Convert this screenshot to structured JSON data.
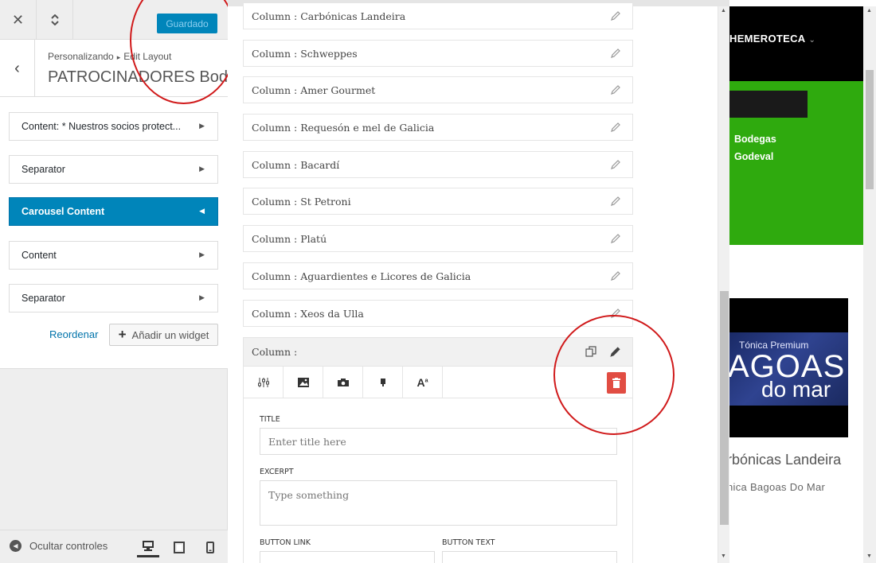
{
  "header": {
    "save_label": "Guardado"
  },
  "title_panel": {
    "breadcrumb_root": "Personalizando",
    "breadcrumb_leaf": "Edit Layout",
    "title": "PATROCINADORES Body"
  },
  "widgets": [
    {
      "label": "Content: * Nuestros socios protect..."
    },
    {
      "label": "Separator"
    },
    {
      "label": "Carousel Content",
      "active": true
    },
    {
      "label": "Content"
    },
    {
      "label": "Separator"
    }
  ],
  "actions": {
    "reorder": "Reordenar",
    "add_widget": "Añadir un widget"
  },
  "footer": {
    "hide_controls": "Ocultar controles"
  },
  "columns": [
    "Column : Carbónicas Landeira",
    "Column : Schweppes",
    "Column : Amer Gourmet",
    "Column : Requesón e mel de Galicia",
    "Column : Bacardí",
    "Column : St Petroni",
    "Column : Platú",
    "Column : Aguardientes e Licores de Galicia",
    "Column : Xeos da Ulla"
  ],
  "active_column": {
    "label": "Column :",
    "fields": {
      "title_label": "TITLE",
      "title_placeholder": "Enter title here",
      "excerpt_label": "EXCERPT",
      "excerpt_placeholder": "Type something",
      "button_link_label": "BUTTON LINK",
      "button_text_label": "BUTTON TEXT"
    }
  },
  "preview": {
    "nav_item": "HEMEROTECA",
    "bodegas_line1": "Bodegas",
    "bodegas_line2": "Godeval",
    "logo_tonica": "Tónica Premium",
    "logo_agoas": "AGOAS",
    "logo_domar": "do mar",
    "heading": "rbónicas Landeira",
    "subheading": "nica Bagoas Do Mar"
  },
  "colors": {
    "primary": "#0085ba",
    "danger": "#e14d43",
    "preview_green": "#2faa0e",
    "annotation": "#d0191a"
  }
}
